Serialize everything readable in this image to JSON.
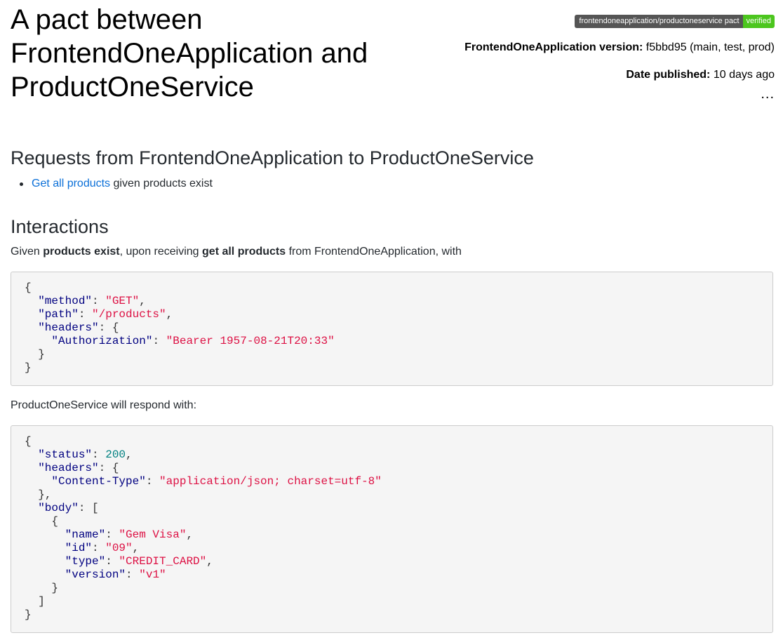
{
  "header": {
    "title": "A pact between FrontendOneApplication and ProductOneService",
    "badge": {
      "label": "frontendoneapplication/productoneservice pact",
      "status": "verified",
      "label_color": "#555555",
      "status_color": "#4cc61e"
    },
    "version_label": "FrontendOneApplication version:",
    "version_value": " f5bbd95 (main, test, prod)",
    "date_label": "Date published:",
    "date_value": " 10 days ago",
    "more": "..."
  },
  "requests": {
    "heading": "Requests from FrontendOneApplication to ProductOneService",
    "items": [
      {
        "link": "Get all products",
        "suffix": " given products exist"
      }
    ]
  },
  "interactions": {
    "heading": "Interactions",
    "given_prefix": "Given ",
    "given_state": "products exist",
    "given_middle": ", upon receiving ",
    "given_description": "get all products",
    "given_suffix": " from FrontendOneApplication, with",
    "request": {
      "method": "GET",
      "path": "/products",
      "headers": {
        "Authorization": "Bearer 1957-08-21T20:33"
      }
    },
    "respond_text": "ProductOneService will respond with:",
    "response": {
      "status": 200,
      "headers": {
        "Content-Type": "application/json; charset=utf-8"
      },
      "body": [
        {
          "name": "Gem Visa",
          "id": "09",
          "type": "CREDIT_CARD",
          "version": "v1"
        }
      ]
    }
  },
  "colors": {
    "link": "#0a6fd8",
    "json_key": "#000080",
    "json_string": "#dd1144",
    "json_number": "#008080",
    "code_background": "#f5f5f5"
  }
}
